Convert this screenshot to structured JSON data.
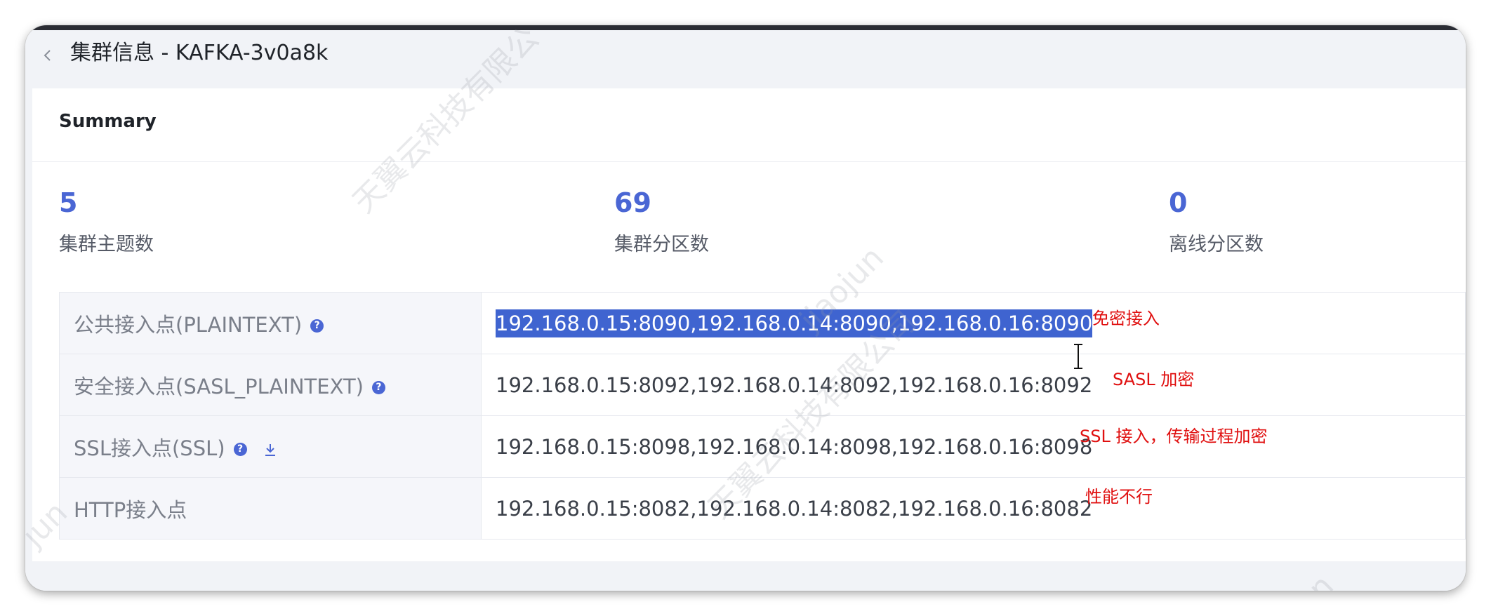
{
  "header": {
    "title": "集群信息 - KAFKA-3v0a8k"
  },
  "summary": {
    "title": "Summary",
    "stats": [
      {
        "value": "5",
        "label": "集群主题数"
      },
      {
        "value": "69",
        "label": "集群分区数"
      },
      {
        "value": "0",
        "label": "离线分区数"
      }
    ]
  },
  "endpoints": [
    {
      "label": "公共接入点(PLAINTEXT)",
      "address": "192.168.0.15:8090,192.168.0.14:8090,192.168.0.16:8090",
      "note": "免密接入",
      "selected": true
    },
    {
      "label": "安全接入点(SASL_PLAINTEXT)",
      "address": "192.168.0.15:8092,192.168.0.14:8092,192.168.0.16:8092",
      "note": "SASL 加密"
    },
    {
      "label": "SSL接入点(SSL)",
      "address": "192.168.0.15:8098,192.168.0.14:8098,192.168.0.16:8098",
      "note": "SSL 接入，传输过程加密"
    },
    {
      "label": "HTTP接入点",
      "address": "192.168.0.15:8082,192.168.0.14:8082,192.168.0.16:8082",
      "note": "性能不行"
    }
  ],
  "help_icon_glyph": "?",
  "watermarks": [
    "天翼云科技有限公",
    "jiaojun",
    "天翼云科技有限公司",
    "jun",
    "n"
  ],
  "colors": {
    "accent": "#4a66d4",
    "selection": "#3f64d0",
    "note": "#e01010"
  }
}
